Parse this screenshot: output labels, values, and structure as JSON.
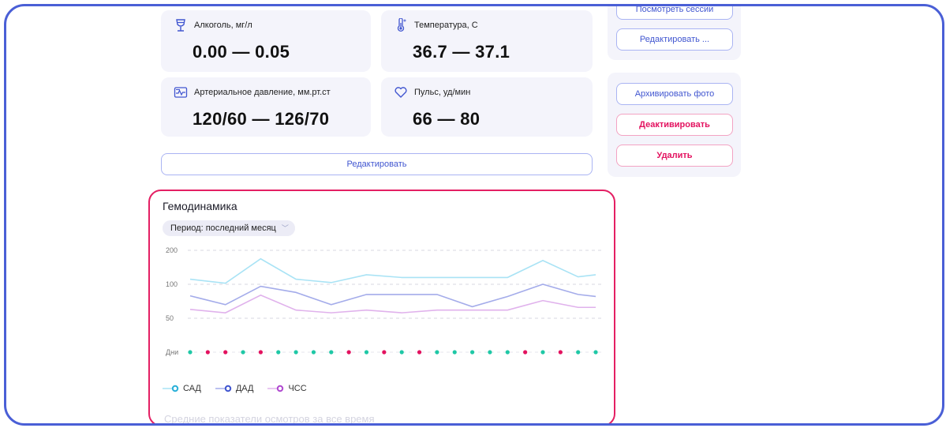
{
  "cards": {
    "alcohol": {
      "label": "Алкоголь, мг/л",
      "value": "0.00 — 0.05"
    },
    "temperature": {
      "label": "Температура, С",
      "value": "36.7 — 37.1"
    },
    "pressure": {
      "label": "Артериальное давление, мм.рт.ст",
      "value": "120/60 — 126/70"
    },
    "pulse": {
      "label": "Пульс, уд/мин",
      "value": "66 — 80"
    }
  },
  "buttons": {
    "view_sessions": "Посмотреть сессии",
    "edit_top": "Редактировать ...",
    "edit_main": "Редактировать",
    "archive_photo": "Архивировать фото",
    "deactivate": "Деактивировать",
    "delete": "Удалить"
  },
  "colors": {
    "accent_blue": "#4156d0",
    "accent_pink": "#e3125f",
    "frame": "#4a5fd6"
  },
  "chart": {
    "title": "Гемодинамика",
    "period": "Период: последний месяц",
    "footer_text": "Средние показатели осмотров за все время"
  },
  "chart_data": {
    "type": "line",
    "y_ticks": [
      "200",
      "100",
      "50"
    ],
    "y_tick_values": [
      200,
      100,
      50
    ],
    "days_label": "Дни",
    "x": [
      1,
      2,
      3,
      4,
      5,
      6,
      7,
      8,
      9,
      10,
      11,
      12,
      13,
      14,
      15,
      16,
      17,
      18,
      19,
      20,
      21,
      22,
      23,
      24
    ],
    "day_marker_colors": [
      "#1fc8a6",
      "#e3125f",
      "#e3125f",
      "#1fc8a6",
      "#e3125f",
      "#1fc8a6",
      "#1fc8a6",
      "#1fc8a6",
      "#1fc8a6",
      "#e3125f",
      "#1fc8a6",
      "#e3125f",
      "#1fc8a6",
      "#e3125f",
      "#1fc8a6",
      "#1fc8a6",
      "#1fc8a6",
      "#1fc8a6",
      "#1fc8a6",
      "#e3125f",
      "#1fc8a6",
      "#e3125f",
      "#1fc8a6",
      "#1fc8a6"
    ],
    "series": [
      {
        "name": "САД",
        "color": "#a9e3f5",
        "marker": "#2ab0d8",
        "x": [
          1,
          3,
          5,
          7,
          9,
          11,
          13,
          15,
          17,
          19,
          21,
          23,
          24
        ],
        "values": [
          115,
          103,
          175,
          115,
          105,
          128,
          120,
          120,
          120,
          120,
          170,
          122,
          128
        ]
      },
      {
        "name": "ДАД",
        "color": "#a4acea",
        "marker": "#4156d0",
        "x": [
          1,
          3,
          5,
          7,
          9,
          11,
          13,
          15,
          17,
          19,
          21,
          23,
          24
        ],
        "values": [
          83,
          70,
          97,
          88,
          70,
          85,
          85,
          85,
          67,
          82,
          100,
          85,
          82
        ]
      },
      {
        "name": "ЧСС",
        "color": "#e0b2ec",
        "marker": "#b04ad0",
        "x": [
          1,
          3,
          5,
          7,
          9,
          11,
          13,
          15,
          17,
          19,
          21,
          23,
          24
        ],
        "values": [
          63,
          58,
          84,
          62,
          58,
          62,
          58,
          62,
          62,
          62,
          76,
          66,
          66
        ]
      }
    ]
  }
}
